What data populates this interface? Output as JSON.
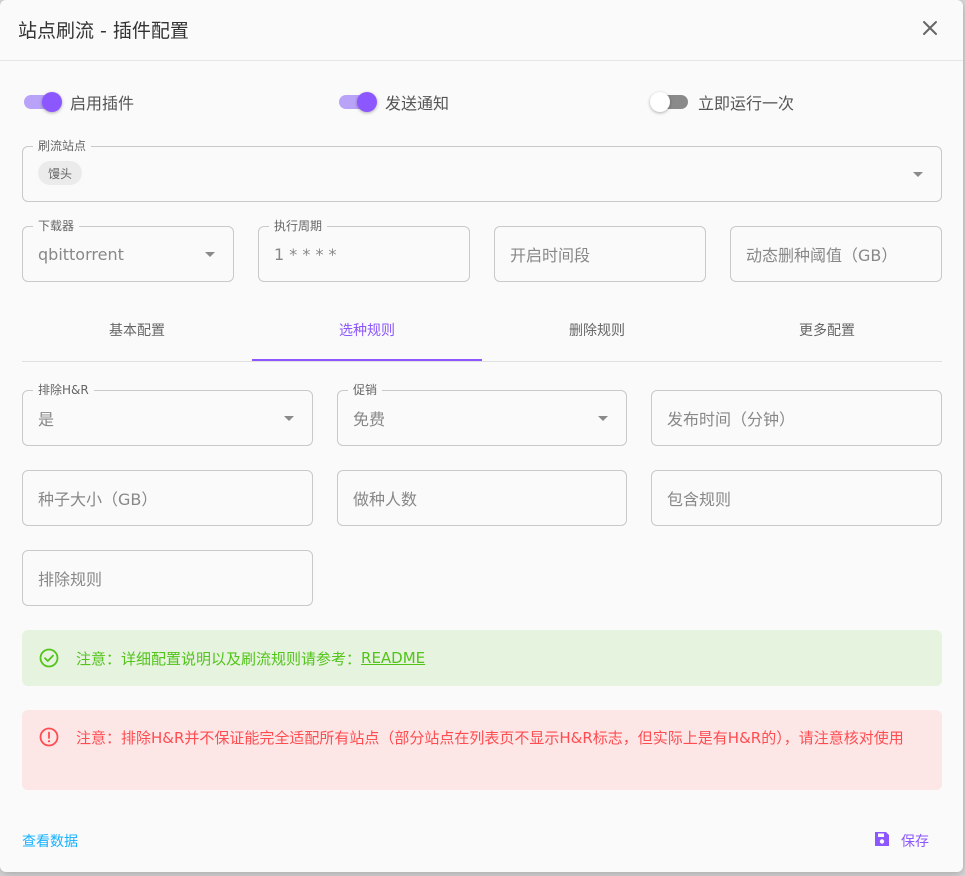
{
  "dialog": {
    "title": "站点刷流 - 插件配置",
    "close_icon": "close-icon"
  },
  "switches": [
    {
      "label": "启用插件",
      "on": true
    },
    {
      "label": "发送通知",
      "on": true
    },
    {
      "label": "立即运行一次",
      "on": false
    }
  ],
  "sites_field": {
    "label": "刷流站点",
    "chips": [
      "馒头"
    ]
  },
  "downloader": {
    "label": "下载器",
    "value": "qbittorrent"
  },
  "cron": {
    "label": "执行周期",
    "value": "1 * * * *"
  },
  "time_range": {
    "placeholder": "开启时间段"
  },
  "delete_threshold": {
    "placeholder": "动态删种阈值（GB）"
  },
  "tabs": [
    {
      "label": "基本配置"
    },
    {
      "label": "选种规则"
    },
    {
      "label": "删除规则"
    },
    {
      "label": "更多配置"
    }
  ],
  "active_tab": "选种规则",
  "rules": {
    "exclude_hr": {
      "label": "排除H&R",
      "value": "是"
    },
    "promotion": {
      "label": "促销",
      "value": "免费"
    },
    "publish_time": {
      "placeholder": "发布时间（分钟）"
    },
    "size": {
      "placeholder": "种子大小（GB）"
    },
    "seeders": {
      "placeholder": "做种人数"
    },
    "include": {
      "placeholder": "包含规则"
    },
    "exclude": {
      "placeholder": "排除规则"
    }
  },
  "alerts": {
    "info_text": "注意：详细配置说明以及刷流规则请参考：",
    "info_link": "README",
    "warning_text": "注意：排除H&R并不保证能完全适配所有站点（部分站点在列表页不显示H&R标志，但实际上是有H&R的），请注意核对使用"
  },
  "footer": {
    "view_data": "查看数据",
    "save": "保存"
  },
  "colors": {
    "accent": "#8c57ff",
    "success": "#52c41a",
    "error": "#ff4c51",
    "link": "#16b1ff"
  }
}
